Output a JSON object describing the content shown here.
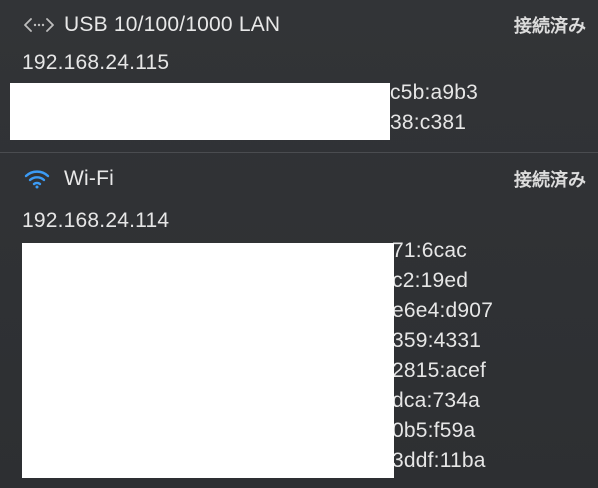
{
  "usb": {
    "name": "USB 10/100/1000 LAN",
    "status": "接続済み",
    "ipv4": "192.168.24.115",
    "ipv6_visible": [
      "c5b:a9b3",
      "38:c381"
    ],
    "icon": "ethernet-arrows-icon"
  },
  "wifi": {
    "name": "Wi-Fi",
    "status": "接続済み",
    "ipv4": "192.168.24.114",
    "ipv6_visible": [
      "71:6cac",
      "c2:19ed",
      "e6e4:d907",
      "359:4331",
      "2815:acef",
      "dca:734a",
      "0b5:f59a",
      "3ddf:11ba"
    ],
    "icon": "wifi-icon"
  },
  "colors": {
    "background": "#2f3134",
    "text": "#e6e6e6",
    "wifi_accent": "#3b9bf5"
  }
}
